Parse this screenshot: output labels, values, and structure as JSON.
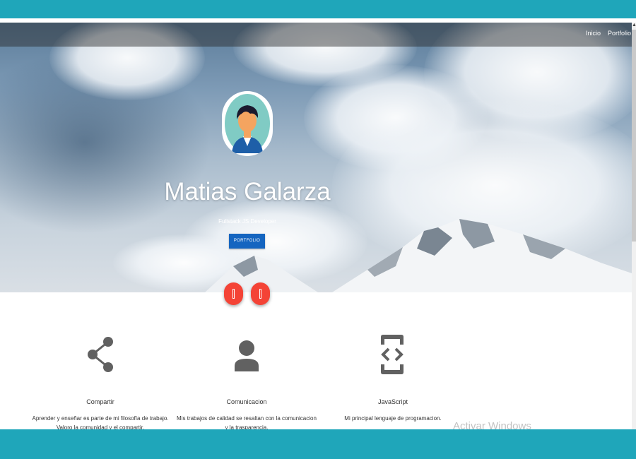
{
  "nav": {
    "items": [
      {
        "label": "Inicio"
      },
      {
        "label": "Portfolio"
      }
    ]
  },
  "hero": {
    "name": "Matias Galarza",
    "subtitle": "Fullstack JS Developer",
    "button_label": "PORTFOLIO"
  },
  "features": [
    {
      "icon": "share-icon",
      "title": "Compartir",
      "text": "Aprender y enseñar es parte de mi filosofía de trabajo. Valoro la comunidad y el compartir."
    },
    {
      "icon": "person-icon",
      "title": "Comunicacion",
      "text": "Mis trabajos de calidad se resaltan con la comunicacion y la trasparencia."
    },
    {
      "icon": "developer-mode-icon",
      "title": "JavaScript",
      "text": "Mi principal lenguaje de programacion."
    }
  ],
  "watermark": "Activar Windows",
  "colors": {
    "frame": "#1fa6ba",
    "button": "#1565c0",
    "fab": "#f44336",
    "icon": "#616161"
  }
}
